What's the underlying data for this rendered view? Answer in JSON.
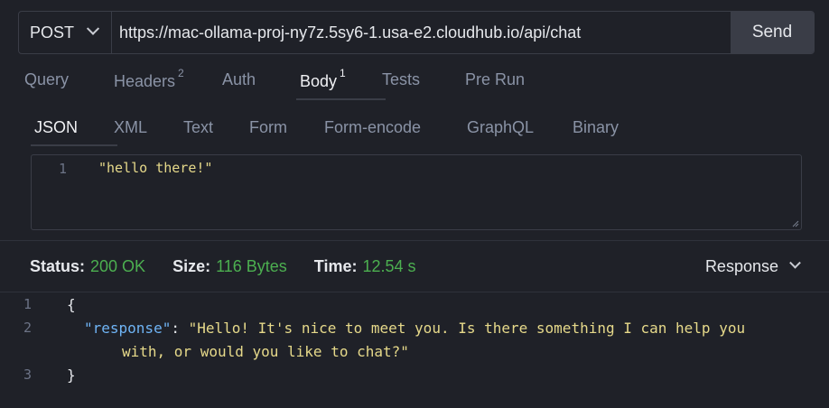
{
  "request": {
    "method": "POST",
    "url": "https://mac-ollama-proj-ny7z.5sy6-1.usa-e2.cloudhub.io/api/chat",
    "send_label": "Send"
  },
  "tabs": [
    {
      "label": "Query",
      "badge": ""
    },
    {
      "label": "Headers",
      "badge": "2"
    },
    {
      "label": "Auth",
      "badge": ""
    },
    {
      "label": "Body",
      "badge": "1"
    },
    {
      "label": "Tests",
      "badge": ""
    },
    {
      "label": "Pre Run",
      "badge": ""
    }
  ],
  "active_tab": "Body",
  "body_tabs": [
    "JSON",
    "XML",
    "Text",
    "Form",
    "Form-encode",
    "GraphQL",
    "Binary"
  ],
  "active_body_tab": "JSON",
  "editor": {
    "line_number": "1",
    "content": "\"hello there!\""
  },
  "status": {
    "status_label": "Status:",
    "status_value": "200 OK",
    "size_label": "Size:",
    "size_value": "116 Bytes",
    "time_label": "Time:",
    "time_value": "12.54 s",
    "view_select": "Response"
  },
  "response": {
    "line1_num": "1",
    "line1": "{",
    "line2_num": "2",
    "key": "\"response\"",
    "colon": ": ",
    "value_part1": "\"Hello! It's nice to meet you. Is there something I can help you",
    "value_part2": "with, or would you like to chat?\"",
    "line3_num": "3",
    "line3": "}"
  },
  "colors": {
    "background": "#1f2128",
    "status_green": "#4caf50",
    "json_key": "#6fb4f5",
    "json_string": "#e6d98a"
  }
}
